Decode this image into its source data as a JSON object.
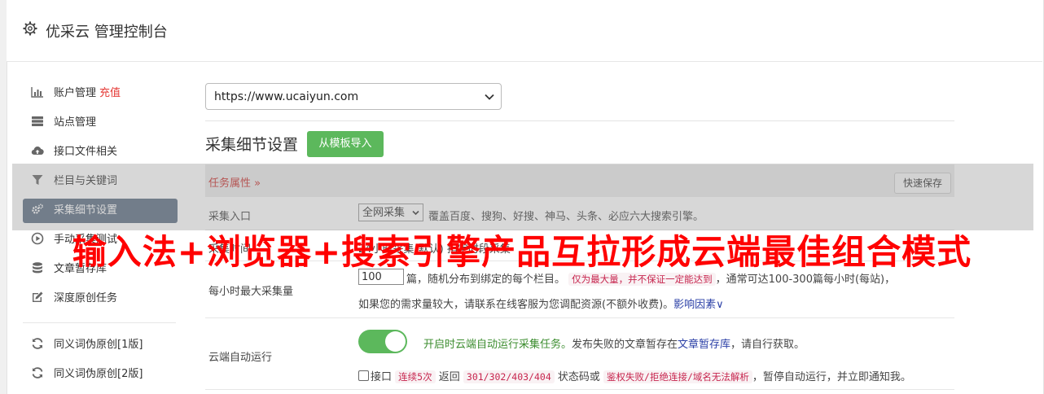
{
  "header": {
    "title": "优采云 管理控制台"
  },
  "sidebar": {
    "items": [
      {
        "label": "账户管理",
        "badge": "充值",
        "icon": "bar-chart-icon"
      },
      {
        "label": "站点管理",
        "icon": "server-icon"
      },
      {
        "label": "接口文件相关",
        "icon": "cloud-upload-icon"
      },
      {
        "label": "栏目与关键词",
        "icon": "filter-icon"
      },
      {
        "label": "采集细节设置",
        "icon": "gears-icon",
        "active": true
      },
      {
        "label": "手动采集测试",
        "icon": "play-circle-icon"
      },
      {
        "label": "文章暂存库",
        "icon": "database-icon"
      },
      {
        "label": "深度原创任务",
        "icon": "edit-icon"
      }
    ],
    "items2": [
      {
        "label": "同义词伪原创[1版]",
        "icon": "refresh-icon"
      },
      {
        "label": "同义词伪原创[2版]",
        "icon": "refresh-icon"
      }
    ]
  },
  "main": {
    "site_select": "https://www.ucaiyun.com",
    "section_title": "采集细节设置",
    "import_button": "从模板导入",
    "task_props": "任务属性 »",
    "quick_save": "快速保存",
    "entry": {
      "label": "采集入口",
      "select_value": "全网采集",
      "desc": "覆盖百度、搜狗、好搜、神马、头条、必应六大搜索引擎。"
    },
    "time": {
      "label": "采集时间",
      "text": "24小时采集(默认) 指定时段采集"
    },
    "hourly": {
      "label": "每小时最大采集量",
      "value": "100",
      "t1": "篇，随机分布到绑定的每个栏目。",
      "code1": "仅为最大量，并不保证一定能达到",
      "t2": "，通常可达100-300篇每小时(每站)，",
      "t3": "如果您的需求量较大，请联系在线客服为您调配资源(不额外收费)。",
      "link": "影响因素"
    },
    "cloud": {
      "label": "云端自动运行",
      "green": "开启时云端自动运行采集任务。",
      "t1": "发布失败的文章暂存在",
      "link": "文章暂存库",
      "t2": "，请自行获取。",
      "c_label": "接口",
      "code1": "连续5次",
      "t3": "返回",
      "code2": "301/302/403/404",
      "t4": "状态码或",
      "code3": "鉴权失败/拒绝连接/域名无法解析",
      "t5": "，暂停自动运行，并立即通知我。"
    }
  },
  "banner": "输入法+浏览器+搜索引擎产品互拉形成云端最佳组合模式",
  "colors": {
    "accent_green": "#5cb85c",
    "active_nav": "#5d6e83",
    "banner_red": "#ff0000"
  }
}
